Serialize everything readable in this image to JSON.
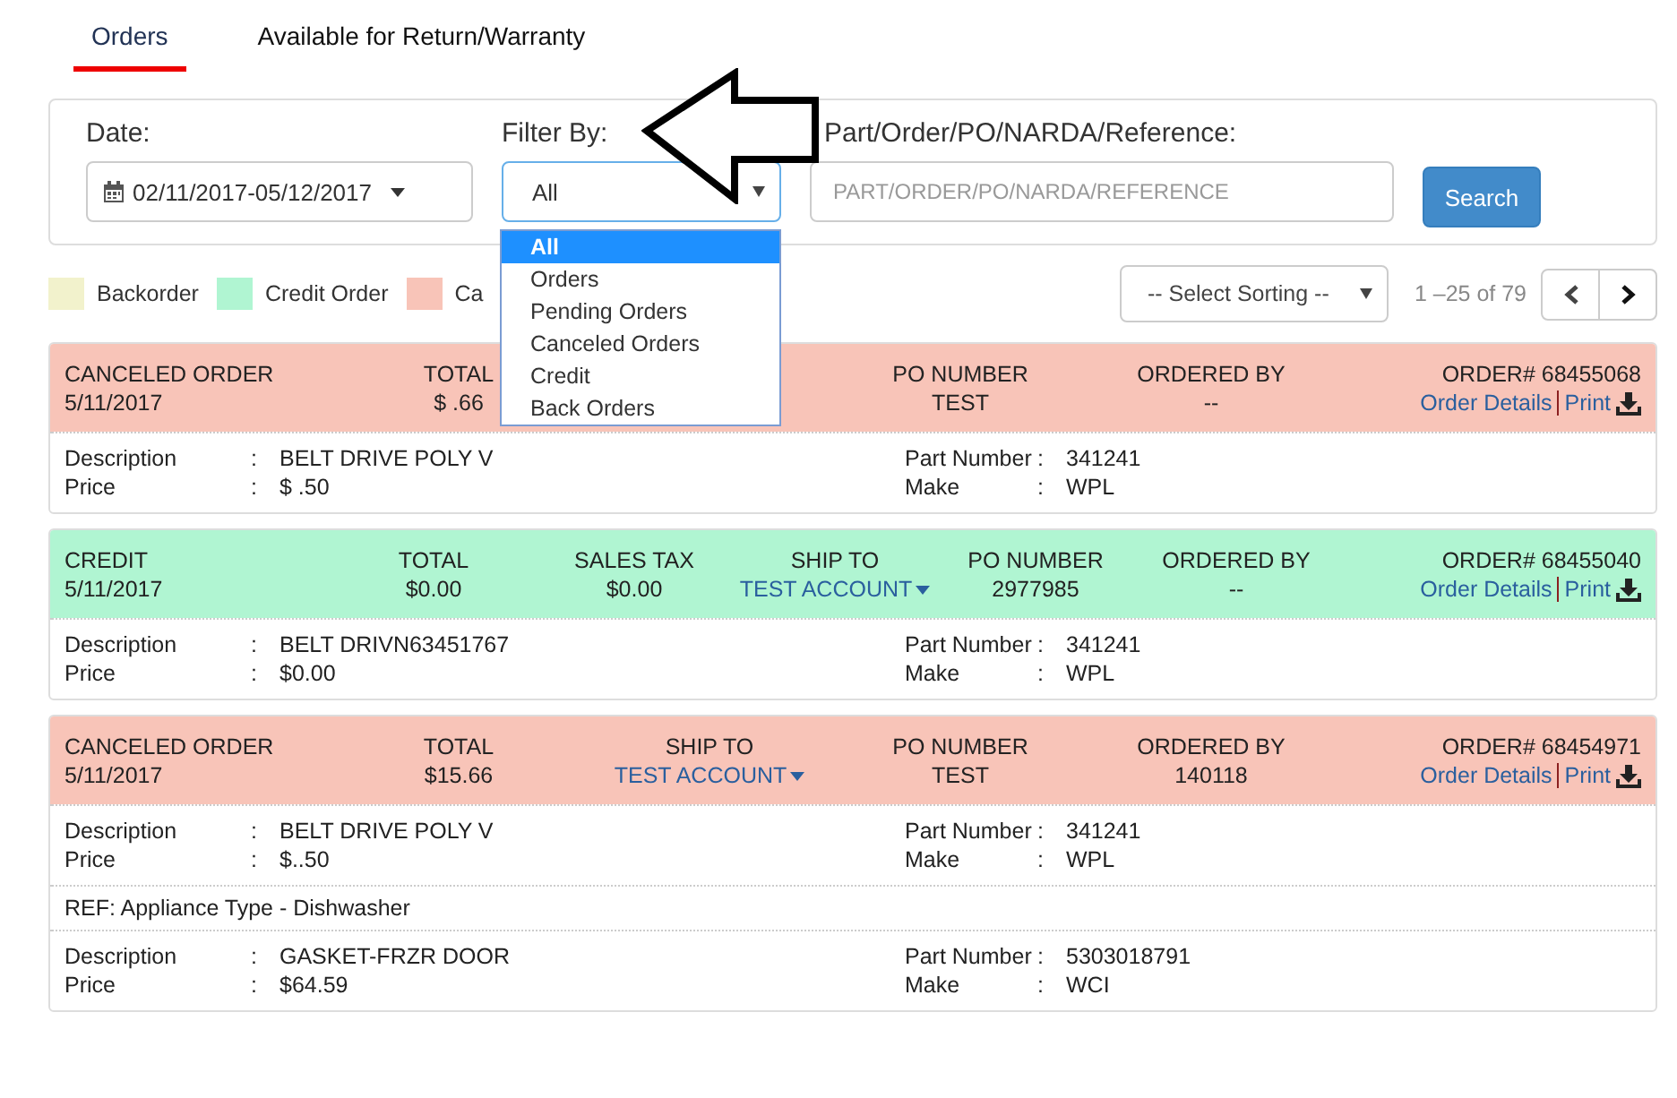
{
  "tabs": [
    {
      "label": "Orders",
      "selected": true
    },
    {
      "label": "Available for Return/Warranty",
      "selected": false
    }
  ],
  "filters": {
    "date_label": "Date:",
    "date_value": "02/11/2017-05/12/2017",
    "filter_label": "Filter By:",
    "filter_value": "All",
    "reference_label": "Part/Order/PO/NARDA/Reference:",
    "reference_placeholder": "PART/ORDER/PO/NARDA/REFERENCE",
    "search_button": "Search",
    "filter_options": [
      {
        "label": "All",
        "selected": true
      },
      {
        "label": "Orders",
        "selected": false
      },
      {
        "label": "Pending Orders",
        "selected": false
      },
      {
        "label": "Canceled Orders",
        "selected": false
      },
      {
        "label": "Credit",
        "selected": false
      },
      {
        "label": "Back Orders",
        "selected": false
      }
    ]
  },
  "legend": [
    {
      "label": "Backorder",
      "color": "#f2f2cc"
    },
    {
      "label": "Credit Order",
      "color": "#b0f5d2"
    },
    {
      "label": "Ca",
      "color": "#f8c4b8"
    }
  ],
  "sorting": {
    "value": "-- Select Sorting --"
  },
  "pagination": {
    "range": "1 –25 of 79"
  },
  "orders": [
    {
      "status": "CANCELED ORDER",
      "date": "5/11/2017",
      "color": "#f8c4b8",
      "order_number": "ORDER# 68455068",
      "details_link": "Order Details",
      "print_link": "Print",
      "columns": [
        {
          "kind": "plain",
          "label": "TOTAL",
          "value": "$ .66"
        },
        {
          "kind": "blank"
        },
        {
          "kind": "plain",
          "label": "PO NUMBER",
          "value": "TEST"
        },
        {
          "kind": "plain",
          "label": "ORDERED BY",
          "value": "--"
        }
      ],
      "lines": [
        {
          "kind": "item",
          "fields": [
            {
              "label": "Description",
              "sep": ":",
              "value": "BELT DRIVE POLY V"
            },
            {
              "label": "Price",
              "sep": ":",
              "value": "$  .50"
            },
            {
              "label": "Part Number",
              "sep": ":",
              "value": "341241"
            },
            {
              "label": "Make",
              "sep": ":",
              "value": "WPL"
            }
          ]
        }
      ]
    },
    {
      "status": "CREDIT",
      "date": "5/11/2017",
      "color": "#b0f5d2",
      "order_number": "ORDER# 68455040",
      "details_link": "Order Details",
      "print_link": "Print",
      "columns": [
        {
          "kind": "plain",
          "label": "TOTAL",
          "value": "$0.00"
        },
        {
          "kind": "plain",
          "label": "SALES TAX",
          "value": "$0.00"
        },
        {
          "kind": "link",
          "label": "SHIP TO",
          "value": "TEST ACCOUNT"
        },
        {
          "kind": "plain",
          "label": "PO NUMBER",
          "value": "2977985"
        },
        {
          "kind": "plain",
          "label": "ORDERED BY",
          "value": "--"
        }
      ],
      "lines": [
        {
          "kind": "item",
          "fields": [
            {
              "label": "Description",
              "sep": ":",
              "value": "BELT DRIVN63451767"
            },
            {
              "label": "Price",
              "sep": ":",
              "value": "$0.00"
            },
            {
              "label": "Part Number",
              "sep": ":",
              "value": "341241"
            },
            {
              "label": "Make",
              "sep": ":",
              "value": "WPL"
            }
          ]
        }
      ]
    },
    {
      "status": "CANCELED ORDER",
      "date": "5/11/2017",
      "color": "#f8c4b8",
      "order_number": "ORDER# 68454971",
      "details_link": "Order Details",
      "print_link": "Print",
      "columns": [
        {
          "kind": "plain",
          "label": "TOTAL",
          "value": "$15.66"
        },
        {
          "kind": "link",
          "label": "SHIP TO",
          "value": "TEST ACCOUNT"
        },
        {
          "kind": "plain",
          "label": "PO NUMBER",
          "value": "TEST"
        },
        {
          "kind": "plain",
          "label": "ORDERED BY",
          "value": "140118"
        }
      ],
      "lines": [
        {
          "kind": "item",
          "fields": [
            {
              "label": "Description",
              "sep": ":",
              "value": "BELT DRIVE POLY V"
            },
            {
              "label": "Price",
              "sep": ":",
              "value": "$..50"
            },
            {
              "label": "Part Number",
              "sep": ":",
              "value": "341241"
            },
            {
              "label": "Make",
              "sep": ":",
              "value": "WPL"
            }
          ]
        },
        {
          "kind": "ref",
          "text": "REF: Appliance Type - Dishwasher"
        },
        {
          "kind": "item",
          "fields": [
            {
              "label": "Description",
              "sep": ":",
              "value": "GASKET-FRZR DOOR"
            },
            {
              "label": "Price",
              "sep": ":",
              "value": "$64.59"
            },
            {
              "label": "Part Number",
              "sep": ":",
              "value": "5303018791"
            },
            {
              "label": "Make",
              "sep": ":",
              "value": "WCI"
            }
          ]
        }
      ]
    }
  ]
}
